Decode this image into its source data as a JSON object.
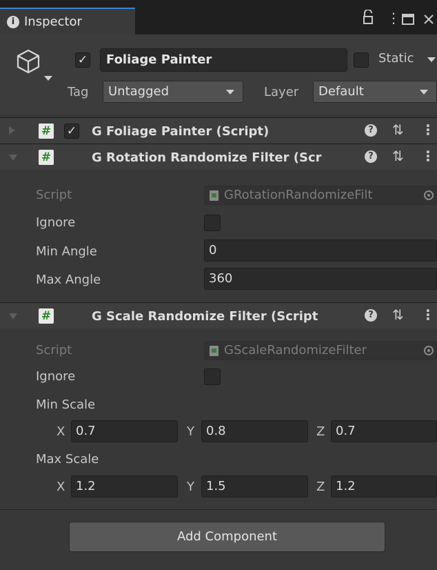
{
  "tab": {
    "icon": "info-icon",
    "label": "Inspector"
  },
  "window_controls": [
    "lock-icon",
    "kebab-menu-icon",
    "maximize-icon",
    "close-icon"
  ],
  "gameobject": {
    "icon": "cube-icon",
    "active": true,
    "name": "Foliage Painter",
    "static_checked": false,
    "static_label": "Static",
    "tag_label": "Tag",
    "tag_value": "Untagged",
    "layer_label": "Layer",
    "layer_value": "Default"
  },
  "components": [
    {
      "title": "G Foliage Painter (Script)",
      "expanded": false,
      "enabled": true
    },
    {
      "title": "G Rotation Randomize Filter (Scr",
      "expanded": true,
      "enabled": null
    },
    {
      "title": "G Scale Randomize Filter (Script",
      "expanded": true,
      "enabled": null
    }
  ],
  "rotation_filter": {
    "script_label": "Script",
    "script_value": "GRotationRandomizeFilt",
    "ignore_label": "Ignore",
    "ignore_checked": false,
    "min_label": "Min Angle",
    "min_value": "0",
    "max_label": "Max Angle",
    "max_value": "360"
  },
  "scale_filter": {
    "script_label": "Script",
    "script_value": "GScaleRandomizeFilter",
    "ignore_label": "Ignore",
    "ignore_checked": false,
    "min_label": "Min Scale",
    "min": {
      "x_label": "X",
      "x": "0.7",
      "y_label": "Y",
      "y": "0.8",
      "z_label": "Z",
      "z": "0.7"
    },
    "max_label": "Max Scale",
    "max": {
      "x_label": "X",
      "x": "1.2",
      "y_label": "Y",
      "y": "1.5",
      "z_label": "Z",
      "z": "1.2"
    }
  },
  "add_component_label": "Add Component"
}
